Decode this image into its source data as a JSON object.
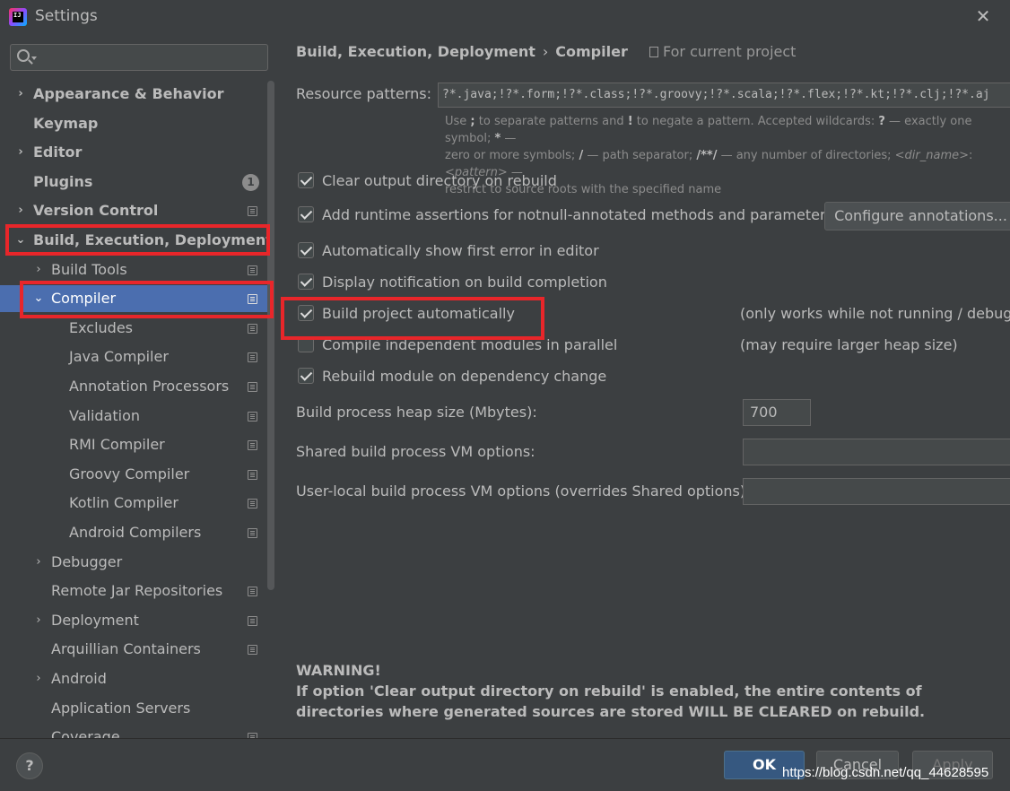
{
  "window": {
    "title": "Settings",
    "app_icon_text": "IJ"
  },
  "sidebar": {
    "search_placeholder": "",
    "items": [
      {
        "label": "Appearance & Behavior",
        "arrow": "›",
        "level": 0,
        "bold": true,
        "icon": false
      },
      {
        "label": "Keymap",
        "arrow": "",
        "level": 0,
        "bold": true,
        "icon": false
      },
      {
        "label": "Editor",
        "arrow": "›",
        "level": 0,
        "bold": true,
        "icon": false
      },
      {
        "label": "Plugins",
        "arrow": "",
        "level": 0,
        "bold": true,
        "icon": false,
        "badge": "1"
      },
      {
        "label": "Version Control",
        "arrow": "›",
        "level": 0,
        "bold": true,
        "icon": true
      },
      {
        "label": "Build, Execution, Deployment",
        "arrow": "⌄",
        "level": 0,
        "bold": true,
        "icon": false
      },
      {
        "label": "Build Tools",
        "arrow": "›",
        "level": 1,
        "bold": false,
        "icon": true
      },
      {
        "label": "Compiler",
        "arrow": "⌄",
        "level": 1,
        "bold": false,
        "icon": true,
        "selected": true
      },
      {
        "label": "Excludes",
        "arrow": "",
        "level": 2,
        "bold": false,
        "icon": true
      },
      {
        "label": "Java Compiler",
        "arrow": "",
        "level": 2,
        "bold": false,
        "icon": true
      },
      {
        "label": "Annotation Processors",
        "arrow": "",
        "level": 2,
        "bold": false,
        "icon": true
      },
      {
        "label": "Validation",
        "arrow": "",
        "level": 2,
        "bold": false,
        "icon": true
      },
      {
        "label": "RMI Compiler",
        "arrow": "",
        "level": 2,
        "bold": false,
        "icon": true
      },
      {
        "label": "Groovy Compiler",
        "arrow": "",
        "level": 2,
        "bold": false,
        "icon": true
      },
      {
        "label": "Kotlin Compiler",
        "arrow": "",
        "level": 2,
        "bold": false,
        "icon": true
      },
      {
        "label": "Android Compilers",
        "arrow": "",
        "level": 2,
        "bold": false,
        "icon": true
      },
      {
        "label": "Debugger",
        "arrow": "›",
        "level": 1,
        "bold": false,
        "icon": false
      },
      {
        "label": "Remote Jar Repositories",
        "arrow": "",
        "level": 1,
        "bold": false,
        "icon": true
      },
      {
        "label": "Deployment",
        "arrow": "›",
        "level": 1,
        "bold": false,
        "icon": true
      },
      {
        "label": "Arquillian Containers",
        "arrow": "",
        "level": 1,
        "bold": false,
        "icon": true
      },
      {
        "label": "Android",
        "arrow": "›",
        "level": 1,
        "bold": false,
        "icon": false
      },
      {
        "label": "Application Servers",
        "arrow": "",
        "level": 1,
        "bold": false,
        "icon": false
      },
      {
        "label": "Coverage",
        "arrow": "",
        "level": 1,
        "bold": false,
        "icon": true
      }
    ]
  },
  "content": {
    "breadcrumb": {
      "parent": "Build, Execution, Deployment",
      "separator": "›",
      "current": "Compiler"
    },
    "for_current_project": "For current project",
    "resource_patterns": {
      "label": "Resource patterns:",
      "value": "?*.java;!?*.form;!?*.class;!?*.groovy;!?*.scala;!?*.flex;!?*.kt;!?*.clj;!?*.aj"
    },
    "hint": {
      "t1": "Use ",
      "b1": ";",
      "t2": " to separate patterns and ",
      "b2": "!",
      "t3": " to negate a pattern. Accepted wildcards: ",
      "b3": "?",
      "t4": " — exactly one symbol; ",
      "b4": "*",
      "t5": " —",
      "t6": "zero or more symbols; ",
      "b5": "/",
      "t7": " — path separator; ",
      "b6": "/**/",
      "t8": " — any number of directories; ",
      "i1": "<dir_name>",
      "t9": ":",
      "i2": "<pattern>",
      "t10": " —",
      "t11": "restrict to source roots with the specified name"
    },
    "options": [
      {
        "label": "Clear output directory on rebuild",
        "checked": true
      },
      {
        "label": "Add runtime assertions for notnull-annotated methods and parameters",
        "checked": true
      },
      {
        "label": "Automatically show first error in editor",
        "checked": true
      },
      {
        "label": "Display notification on build completion",
        "checked": true
      },
      {
        "label": "Build project automatically",
        "checked": true,
        "note": "(only works while not running / debugging)"
      },
      {
        "label": "Compile independent modules in parallel",
        "checked": false,
        "note": "(may require larger heap size)"
      },
      {
        "label": "Rebuild module on dependency change",
        "checked": true
      }
    ],
    "configure_annotations_button": "Configure annotations...",
    "heap_size": {
      "label": "Build process heap size (Mbytes):",
      "value": "700"
    },
    "shared_vm": {
      "label": "Shared build process VM options:",
      "value": ""
    },
    "user_vm": {
      "label": "User-local build process VM options (overrides Shared options):",
      "value": ""
    },
    "warning": {
      "title": "WARNING!",
      "text": "If option 'Clear output directory on rebuild' is enabled, the entire contents of directories where generated sources are stored WILL BE CLEARED on rebuild."
    }
  },
  "footer": {
    "help": "?",
    "ok": "OK",
    "cancel": "Cancel",
    "apply": "Apply",
    "watermark": "https://blog.csdn.net/qq_44628595"
  },
  "colors": {
    "background": "#3c3f41",
    "selection": "#4b6eaf",
    "highlight_box": "#e8262a",
    "ok_button": "#365880"
  }
}
